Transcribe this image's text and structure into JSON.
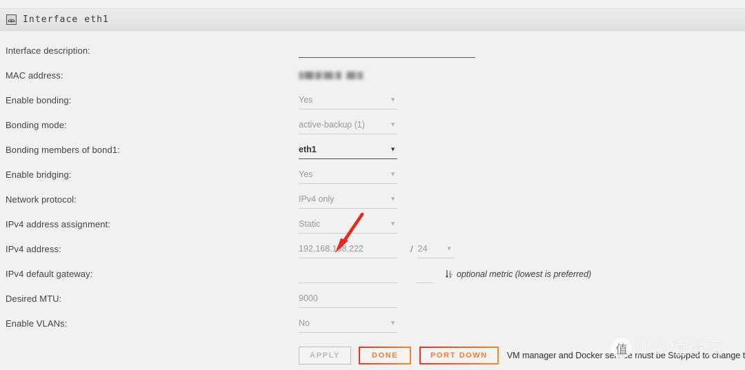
{
  "window": {
    "title": "Interface eth1",
    "icon": "network-interface-icon"
  },
  "form": {
    "rows": [
      {
        "label": "Interface description:",
        "type": "text",
        "value": "",
        "state": "active-empty"
      },
      {
        "label": "MAC address:",
        "type": "redacted",
        "value": "",
        "state": "blurred"
      },
      {
        "label": "Enable bonding:",
        "type": "select",
        "value": "Yes",
        "state": "normal"
      },
      {
        "label": "Bonding mode:",
        "type": "select",
        "value": "active-backup (1)",
        "state": "normal"
      },
      {
        "label": "Bonding members of bond1:",
        "type": "select",
        "value": "eth1",
        "state": "active"
      },
      {
        "label": "Enable bridging:",
        "type": "select",
        "value": "Yes",
        "state": "normal"
      },
      {
        "label": "Network protocol:",
        "type": "select",
        "value": "IPv4 only",
        "state": "normal"
      },
      {
        "label": "IPv4 address assignment:",
        "type": "select",
        "value": "Static",
        "state": "normal"
      },
      {
        "label": "IPv4 address:",
        "type": "text",
        "value": "192.168.198.222",
        "state": "normal"
      },
      {
        "label": "IPv4 default gateway:",
        "type": "text",
        "value": "",
        "state": "normal"
      },
      {
        "label": "Desired MTU:",
        "type": "text",
        "value": "9000",
        "state": "normal"
      },
      {
        "label": "Enable VLANs:",
        "type": "select",
        "value": "No",
        "state": "normal"
      }
    ],
    "ipv4_prefix": {
      "separator": "/",
      "value": "24"
    },
    "metric_note": {
      "icon": "sort-numeric-down-icon",
      "text": "optional metric (lowest is preferred)"
    }
  },
  "buttons": {
    "apply": "APPLY",
    "done": "DONE",
    "port_down": "PORT DOWN"
  },
  "status": {
    "text": "VM manager and Docker service must be Stopped to change these settings)"
  },
  "annotation": {
    "arrow_color": "#e8271f"
  },
  "watermark": {
    "badge": "值",
    "text": "什么值得买"
  },
  "colors": {
    "page_bg": "#f1f1f1",
    "titlebar_bg": "#e6e6e6",
    "label": "#444444",
    "placeholder": "#999999",
    "active_underline": "#4a4a4a",
    "underline": "#cfcfcf",
    "accent_orange": "#f08030",
    "accent_red": "#ee2d24",
    "arrow_red": "#e8271f"
  }
}
